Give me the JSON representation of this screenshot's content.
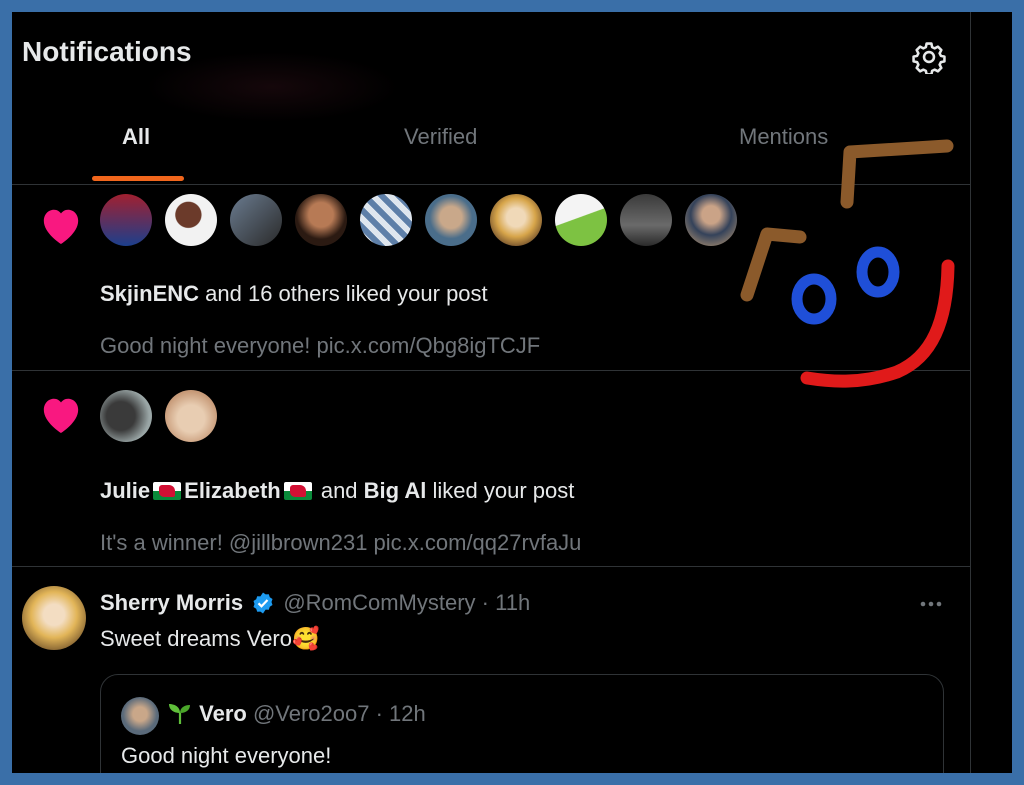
{
  "header": {
    "title": "Notifications",
    "settings_icon": "gear-icon"
  },
  "tabs": [
    {
      "label": "All",
      "active": true
    },
    {
      "label": "Verified",
      "active": false
    },
    {
      "label": "Mentions",
      "active": false
    }
  ],
  "colors": {
    "background": "#000000",
    "accent": "#f1661c",
    "heart": "#f91880",
    "muted": "#71767b",
    "text": "#e7e9ea",
    "verified": "#1d9bf0",
    "frame": "#3a6fa8"
  },
  "notifications": [
    {
      "icon": "heart-icon",
      "avatar_count": 10,
      "actor": "SkjinENC",
      "rest": " and 16 others liked your post",
      "post_preview": "Good night everyone! pic.x.com/Qbg8igTCJF"
    },
    {
      "icon": "heart-icon",
      "avatar_count": 2,
      "actor1": "Julie",
      "actor2": "Elizabeth",
      "connector": " and ",
      "actor3": "Big Al",
      "rest": " liked your post",
      "post_preview": "It's a winner! @jillbrown231 pic.x.com/qq27rvfaJu"
    }
  ],
  "reply": {
    "name": "Sherry Morris",
    "handle": "@RomComMystery",
    "time": "· 11h",
    "text": "Sweet dreams Vero",
    "emoji": "🥰",
    "quote": {
      "name": "Vero",
      "handle": "@Vero2oo7",
      "time": "· 12h",
      "text": "Good night everyone!"
    }
  }
}
